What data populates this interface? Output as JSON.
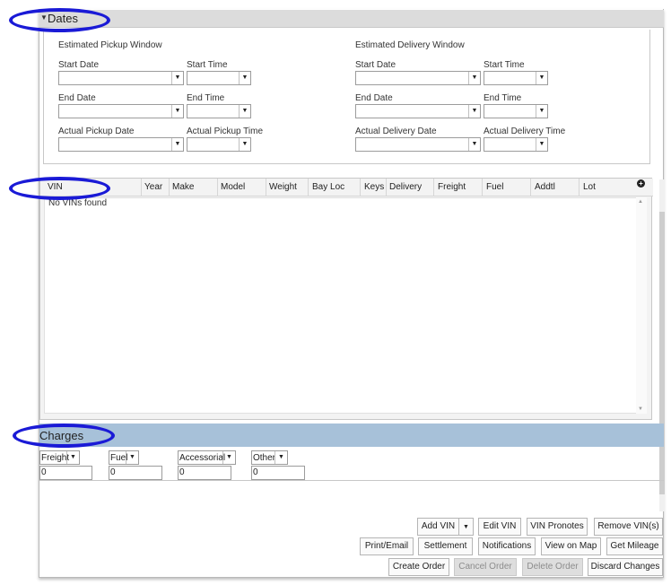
{
  "dates": {
    "title": "Dates",
    "pickup_window": "Estimated Pickup Window",
    "delivery_window": "Estimated Delivery Window",
    "pickup": {
      "start_date": "Start Date",
      "start_time": "Start Time",
      "end_date": "End Date",
      "end_time": "End Time",
      "actual_date": "Actual Pickup Date",
      "actual_time": "Actual Pickup Time"
    },
    "delivery": {
      "start_date": "Start Date",
      "start_time": "Start Time",
      "end_date": "End Date",
      "end_time": "End Time",
      "actual_date": "Actual Delivery Date",
      "actual_time": "Actual Delivery Time"
    }
  },
  "vin_grid": {
    "columns": [
      "VIN",
      "Year",
      "Make",
      "Model",
      "Weight",
      "Bay Loc",
      "Keys",
      "Delivery",
      "Freight",
      "Fuel",
      "Addtl",
      "Lot"
    ],
    "empty_message": "No VINs found"
  },
  "charges": {
    "title": "Charges",
    "items": [
      {
        "label": "Freight",
        "value": "0"
      },
      {
        "label": "Fuel",
        "value": "0"
      },
      {
        "label": "Accessorial",
        "value": "0"
      },
      {
        "label": "Other",
        "value": "0"
      }
    ]
  },
  "actions": {
    "add_vin": "Add VIN",
    "edit_vin": "Edit VIN",
    "vin_pronotes": "VIN Pronotes",
    "remove_vins": "Remove VIN(s)",
    "print_email": "Print/Email",
    "settlement": "Settlement",
    "notifications": "Notifications",
    "view_on_map": "View on Map",
    "get_mileage": "Get Mileage",
    "create_order": "Create Order",
    "cancel_order": "Cancel Order",
    "delete_order": "Delete Order",
    "discard_changes": "Discard Changes"
  },
  "icons": {
    "dates_toggle": "caret-down-icon",
    "dropdown": "chevron-down-icon",
    "add_column": "plus-circle-icon"
  },
  "colors": {
    "dates_header_bg": "#dcdcdc",
    "charges_header_bg": "#a7c1d9",
    "callout": "#1a1ad6"
  }
}
